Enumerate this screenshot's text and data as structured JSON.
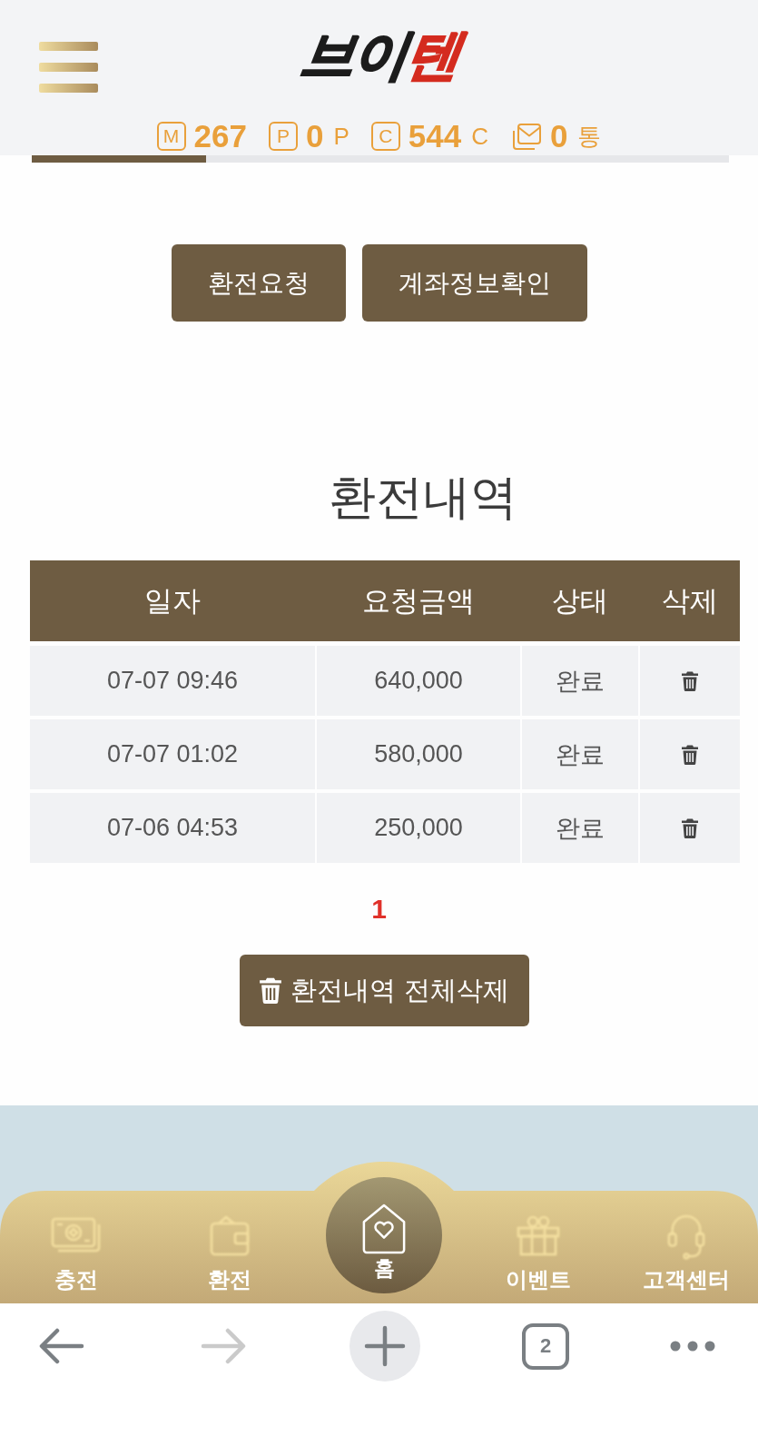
{
  "logo": {
    "parts": [
      {
        "text": "브이",
        "color": "#1c1c1c"
      },
      {
        "text": "텐",
        "color": "#d42b1f"
      }
    ]
  },
  "stats": [
    {
      "kind": "letter",
      "badge": "M",
      "value": "267"
    },
    {
      "kind": "letter",
      "badge": "P",
      "value": "0",
      "unit": "P"
    },
    {
      "kind": "letter",
      "badge": "C",
      "value": "544",
      "unit": "C"
    },
    {
      "kind": "mail",
      "value": "0",
      "unit": "통"
    }
  ],
  "tab_indicator": {
    "level": 0.25
  },
  "actions": [
    "환전요청",
    "계좌정보확인"
  ],
  "history": {
    "title": "환전내역",
    "columns": [
      "일자",
      "요청금액",
      "상태",
      "삭제"
    ],
    "rows": [
      {
        "date": "07-07 09:46",
        "amount": "640,000",
        "status": "완료"
      },
      {
        "date": "07-07 01:02",
        "amount": "580,000",
        "status": "완료"
      },
      {
        "date": "07-06 04:53",
        "amount": "250,000",
        "status": "완료"
      }
    ]
  },
  "pagination": {
    "pages": [
      {
        "label": "1",
        "selected": true
      }
    ]
  },
  "delete_all": {
    "label": "환전내역 전체삭제"
  },
  "bottom_nav": {
    "items": [
      {
        "kind": "charge",
        "label": "충전"
      },
      {
        "kind": "exchange",
        "label": "환전"
      },
      {
        "kind": "home",
        "label": "홈"
      },
      {
        "kind": "event",
        "label": "이벤트"
      },
      {
        "kind": "support",
        "label": "고객센터"
      }
    ]
  },
  "browser_bar": {
    "items": [
      {
        "kind": "back",
        "disabled": false
      },
      {
        "kind": "forward",
        "disabled": true
      },
      {
        "kind": "new_tab"
      },
      {
        "kind": "tabs",
        "count": "2"
      },
      {
        "kind": "more"
      }
    ]
  }
}
